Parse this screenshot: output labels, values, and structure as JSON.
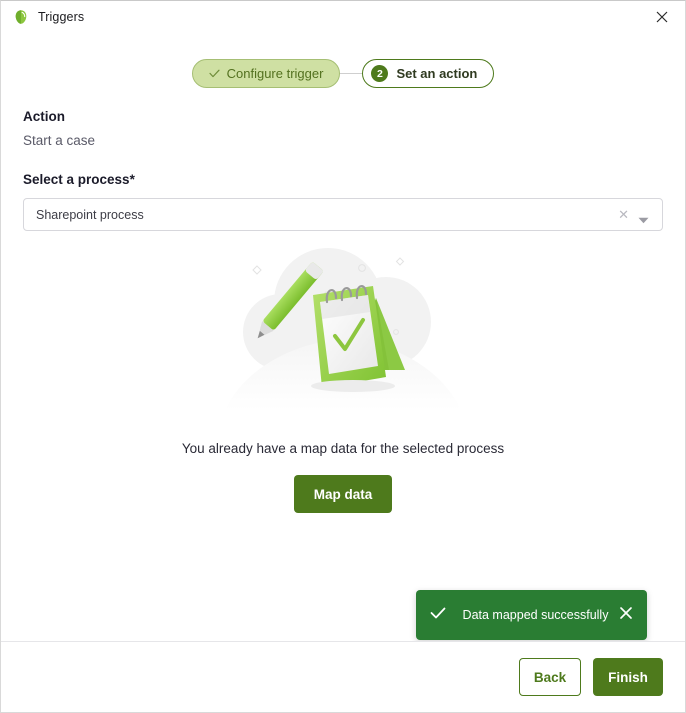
{
  "window": {
    "title": "Triggers",
    "app_icon": "triggers-leaf-icon",
    "close_icon": "close-icon"
  },
  "stepper": {
    "steps": [
      {
        "label": "Configure trigger",
        "state": "completed",
        "icon": "check-icon"
      },
      {
        "label": "Set an action",
        "state": "current",
        "number": "2"
      }
    ]
  },
  "form": {
    "action_label": "Action",
    "action_value": "Start a case",
    "process_label": "Select a process*",
    "process_value": "Sharepoint process",
    "process_placeholder": "Select a process",
    "clear_icon": "close-small-icon",
    "dropdown_icon": "chevron-down-icon"
  },
  "empty_state": {
    "illustration": "notepad-pencil-illustration",
    "message": "You already have a map data for the selected process",
    "map_button": "Map data"
  },
  "toast": {
    "icon": "check-icon",
    "message": "Data mapped successfully",
    "close_icon": "close-icon"
  },
  "footer": {
    "back_label": "Back",
    "finish_label": "Finish"
  },
  "colors": {
    "brand_green": "#4e7a1c",
    "pill_done_bg": "#cfe0a3",
    "pill_done_text": "#53711f",
    "toast_green": "#2a7d33",
    "illustration_green": "#97d04f",
    "illustration_gray": "#f2f2f2"
  }
}
